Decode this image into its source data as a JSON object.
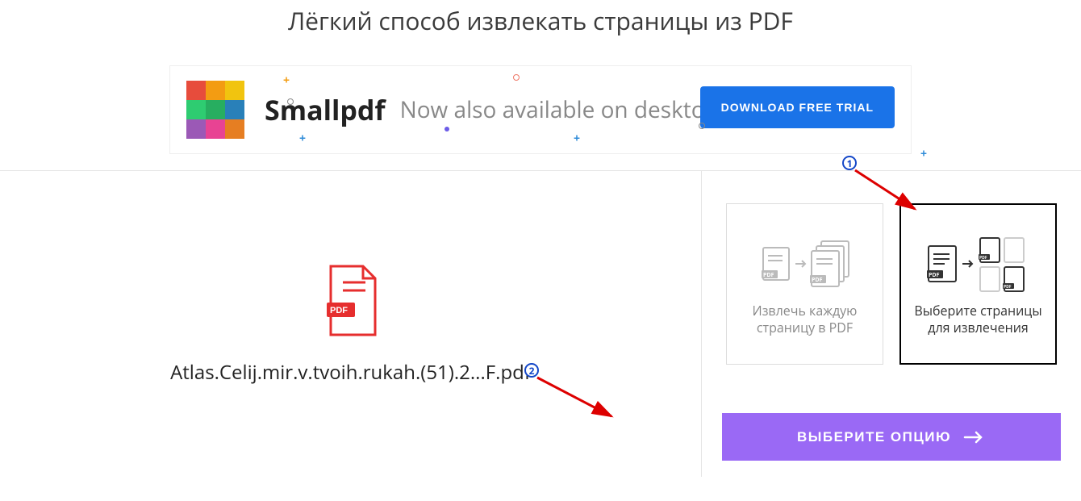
{
  "title": "Лёгкий способ извлекать страницы из PDF",
  "banner": {
    "brand": "Smallpdf",
    "subtitle": "Now also available on desktop",
    "button": "DOWNLOAD FREE TRIAL",
    "logo_colors": [
      "#e74c3c",
      "#f39c12",
      "#f1c40f",
      "#2ecc71",
      "#27ae60",
      "#2980b9",
      "#9b59b6",
      "#e84393",
      "#e67e22"
    ]
  },
  "file_name": "Atlas.Celij.mir.v.tvoih.rukah.(51).2...F.pdf",
  "options": {
    "extract_all": "Извлечь каждую страницу в PDF",
    "select_pages": "Выберите страницы для извлечения"
  },
  "choose_button": "ВЫБЕРИТЕ ОПЦИЮ",
  "annotations": {
    "step1": "1",
    "step2": "2"
  }
}
